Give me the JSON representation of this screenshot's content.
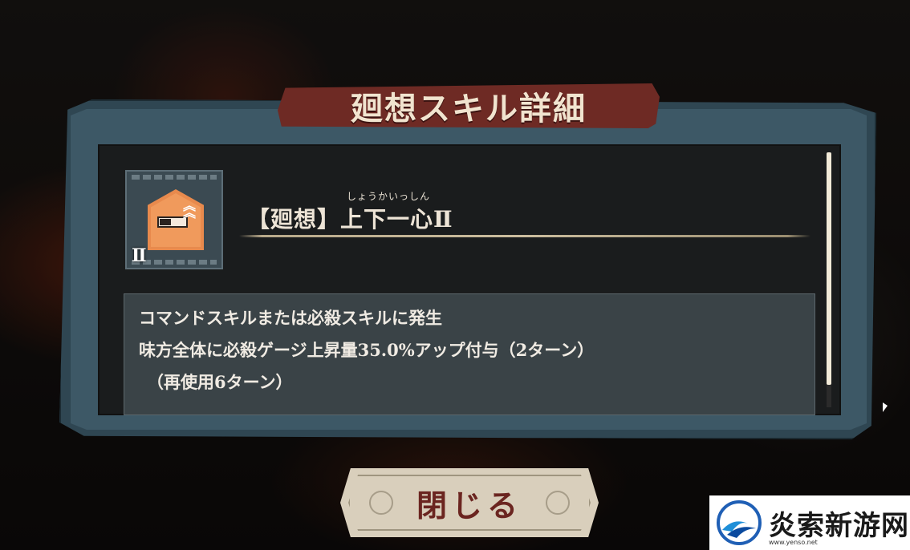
{
  "dialog": {
    "title": "廻想スキル詳細",
    "skill": {
      "rank": "Ⅱ",
      "name_ruby": "しょうかいっしん",
      "name": "【廻想】上下一心Ⅱ",
      "icon": "gauge-up-icon",
      "icon_color": "#e88a4d"
    },
    "description": [
      "コマンドスキルまたは必殺スキルに発生",
      "味方全体に必殺ゲージ上昇量35.0%アップ付与（2ターン）",
      "（再使用6ターン）"
    ],
    "close_label": "閉じる"
  },
  "watermark": {
    "text": "炎索新游网",
    "url": "www.yenso.net"
  },
  "colors": {
    "banner": "#6e2a24",
    "frame": "#3d5866",
    "close_text": "#6b2520"
  }
}
